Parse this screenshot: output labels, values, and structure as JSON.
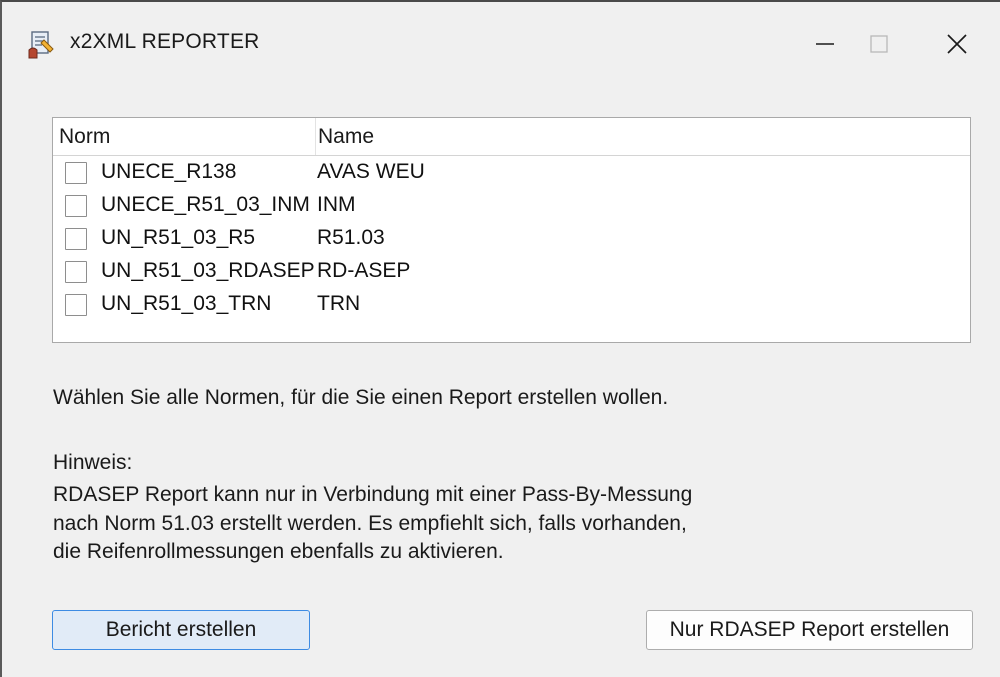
{
  "window": {
    "title": "x2XML REPORTER",
    "controls": {
      "minimize": "—",
      "maximize": "☐",
      "close": "✕"
    }
  },
  "norm_list": {
    "columns": {
      "norm": "Norm",
      "name": "Name"
    },
    "rows": [
      {
        "norm": "UNECE_R138",
        "name": "AVAS WEU",
        "checked": false
      },
      {
        "norm": "UNECE_R51_03_INM",
        "name": "INM",
        "checked": false
      },
      {
        "norm": "UN_R51_03_R5",
        "name": "R51.03",
        "checked": false
      },
      {
        "norm": "UN_R51_03_RDASEP",
        "name": "RD-ASEP",
        "checked": false
      },
      {
        "norm": "UN_R51_03_TRN",
        "name": "TRN",
        "checked": false
      }
    ]
  },
  "instructions": {
    "select_text": "Wählen Sie alle Normen, für die Sie einen Report erstellen wollen.",
    "hint_title": "Hinweis:",
    "hint_lines": [
      "RDASEP Report kann nur in Verbindung mit einer Pass-By-Messung",
      "nach Norm 51.03 erstellt werden. Es empfiehlt sich, falls vorhanden,",
      "die Reifenrollmessungen ebenfalls zu aktivieren."
    ]
  },
  "buttons": {
    "create_report": "Bericht erstellen",
    "create_rdasep_only": "Nur RDASEP Report erstellen"
  },
  "colors": {
    "window_bg": "#f0f0f0",
    "primary_button_border": "#3d8be3",
    "primary_button_bg": "#e1ebf7"
  }
}
